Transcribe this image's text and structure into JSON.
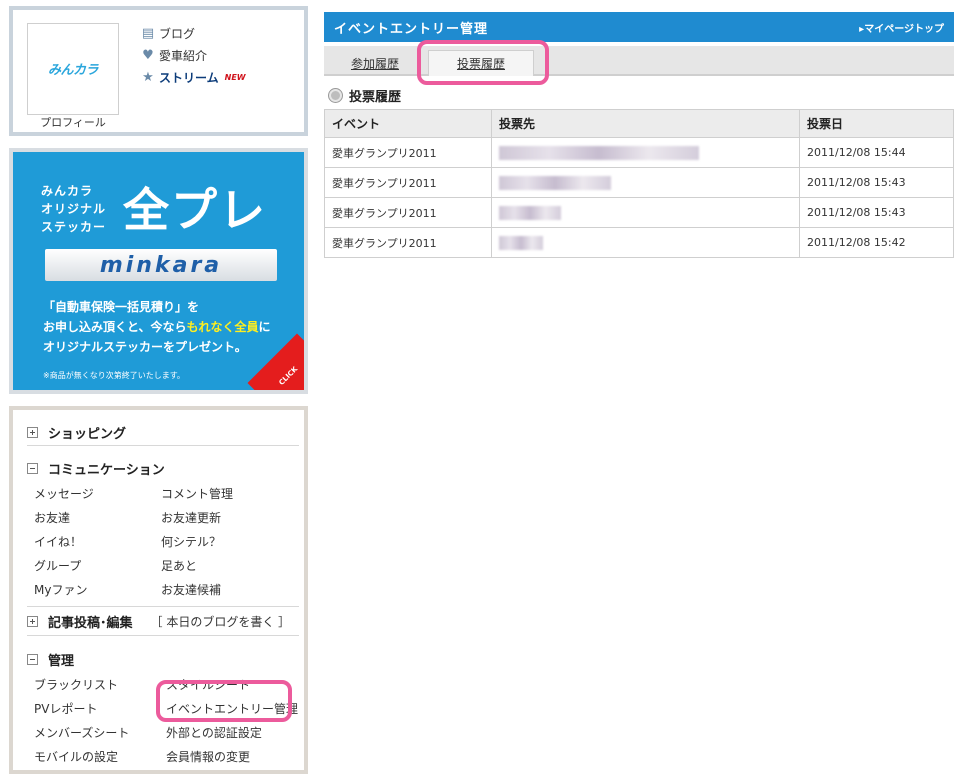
{
  "profile": {
    "logo_text": "みんカラ",
    "caption": "プロフィール",
    "links": [
      {
        "label": "ブログ",
        "icon": "document-icon"
      },
      {
        "label": "愛車紹介",
        "icon": "heart-icon"
      },
      {
        "label": "ストリーム",
        "icon": "star-icon",
        "badge": "NEW"
      }
    ]
  },
  "banner": {
    "small_lines": [
      "みんカラ",
      "オリジナル",
      "ステッカー"
    ],
    "big_text": "全プレ",
    "logo_text": "minkara",
    "line1": "「自動車保険一括見積り」を",
    "line2_pre": "お申し込み頂くと、今なら",
    "line2_hl": "もれなく全員",
    "line2_post": "に",
    "line3": "オリジナルステッカーをプレゼント。",
    "note": "※商品が無くなり次第終了いたします。",
    "corner": "CLICK"
  },
  "menu": {
    "shopping": "ショッピング",
    "communication": "コミュニケーション",
    "comm_items": [
      "メッセージ",
      "コメント管理",
      "お友達",
      "お友達更新",
      "イイね！",
      "何シテル？",
      "グループ",
      "足あと",
      "Myファン",
      "お友達候補"
    ],
    "posting": "記事投稿･編集",
    "posting_extra": "［ 本日のブログを書く ］",
    "admin": "管理",
    "admin_items": [
      "ブラックリスト",
      "スタイルシート",
      "PVレポート",
      "イベントエントリー管理",
      "メンバーズシート",
      "外部との認証設定",
      "モバイルの設定",
      "会員情報の変更"
    ]
  },
  "header": {
    "title": "イベントエントリー管理",
    "mypage": "▸マイページトップ"
  },
  "tabs": [
    "参加履歴",
    "投票履歴"
  ],
  "section_title": "投票履歴",
  "table": {
    "columns": [
      "イベント",
      "投票先",
      "投票日"
    ],
    "rows": [
      {
        "event": "愛車グランプリ2011",
        "date": "2011/12/08 15:44",
        "blur_w": 200
      },
      {
        "event": "愛車グランプリ2011",
        "date": "2011/12/08 15:43",
        "blur_w": 112
      },
      {
        "event": "愛車グランプリ2011",
        "date": "2011/12/08 15:43",
        "blur_w": 62
      },
      {
        "event": "愛車グランプリ2011",
        "date": "2011/12/08 15:42",
        "blur_w": 44
      }
    ]
  },
  "colors": {
    "accent": "#1f8bd0",
    "highlight": "#ec5b9c",
    "banner": "#1f9bd7"
  }
}
